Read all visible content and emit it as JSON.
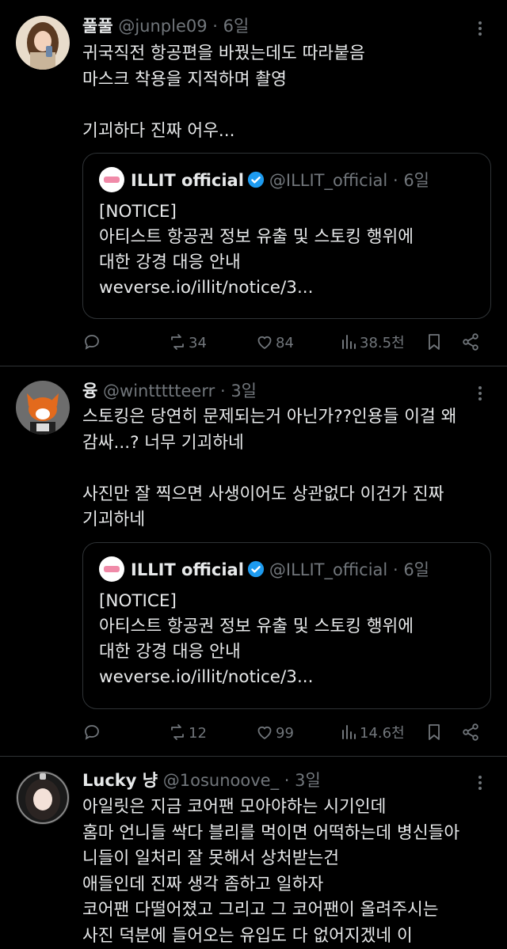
{
  "tweets": [
    {
      "name": "풀풀",
      "handle": "@junple09",
      "dot": "·",
      "time": "6일",
      "lines": [
        "귀국직전 항공편을 바꿨는데도 따라붙음",
        "마스크 착용을 지적하며 촬영",
        "",
        "기괴하다 진짜 어우..."
      ],
      "quote": {
        "name": "ILLIT official",
        "handle": "@ILLIT_official",
        "dot": "·",
        "time": "6일",
        "lines": [
          "[NOTICE]",
          "아티스트 항공권 정보 유출 및 스토킹 행위에",
          "대한 강경 대응 안내",
          "weverse.io/illit/notice/3..."
        ]
      },
      "retweets": "34",
      "likes": "84",
      "views": "38.5천"
    },
    {
      "name": "융",
      "handle": "@winttttteerr",
      "dot": "·",
      "time": "3일",
      "lines": [
        "스토킹은 당연히 문제되는거 아닌가??인용들 이걸 왜",
        "감싸...? 너무 기괴하네",
        "",
        "사진만 잘 찍으면 사생이어도 상관없다 이건가 진짜",
        "기괴하네"
      ],
      "quote": {
        "name": "ILLIT official",
        "handle": "@ILLIT_official",
        "dot": "·",
        "time": "6일",
        "lines": [
          "[NOTICE]",
          "아티스트 항공권 정보 유출 및 스토킹 행위에",
          "대한 강경 대응 안내",
          "weverse.io/illit/notice/3..."
        ]
      },
      "retweets": "12",
      "likes": "99",
      "views": "14.6천"
    },
    {
      "name": "Lucky 냥",
      "handle": "@1osunoove_",
      "dot": "·",
      "time": "3일",
      "lines": [
        "아일릿은 지금 코어팬 모아야하는 시기인데",
        "홈마 언니들 싹다 블리를 먹이면 어떡하는데 병신들아",
        "니들이 일처리 잘 못해서 상처받는건",
        "애들인데 진짜 생각 좀하고 일하자",
        "코어팬 다떨어졌고 그리고 그 코어팬이 올려주시는",
        "사진 덕분에 들어오는 유입도 다 없어지겠네 이"
      ]
    }
  ],
  "colors": {
    "background": "#000000",
    "text": "#e7e9ea",
    "muted": "#71767b",
    "border": "#2f3336",
    "verified": "#1d9bf0"
  }
}
